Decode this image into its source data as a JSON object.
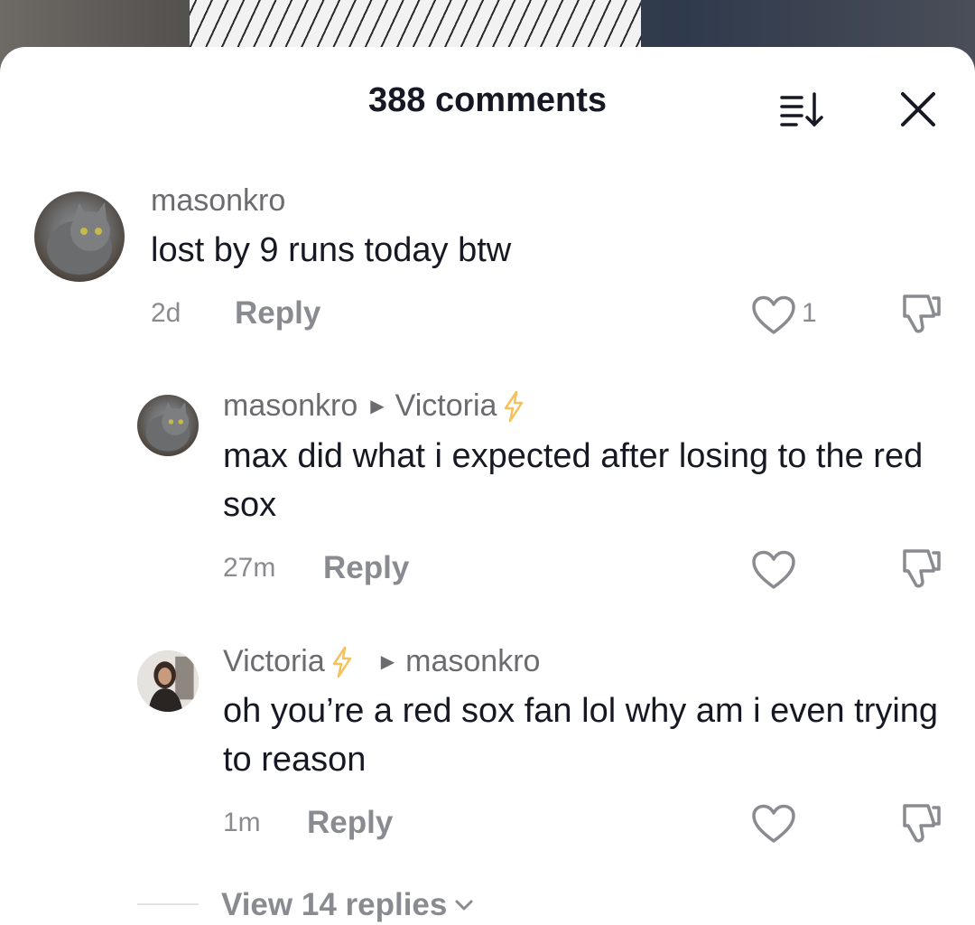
{
  "header": {
    "title": "388 comments"
  },
  "comments": [
    {
      "username": "masonkro",
      "text": "lost by 9 runs today btw",
      "time": "2d",
      "reply_label": "Reply",
      "likes": "1"
    },
    {
      "username": "masonkro",
      "reply_to": "Victoria",
      "text": "max did what i expected after losing to the red sox",
      "time": "27m",
      "reply_label": "Reply"
    },
    {
      "username": "Victoria",
      "reply_to": "masonkro",
      "text": "oh you’re a red sox fan lol why am i even trying to reason",
      "time": "1m",
      "reply_label": "Reply"
    }
  ],
  "view_replies": "View 14 replies",
  "colors": {
    "primary_text": "#161823",
    "secondary_text": "#8a8b91",
    "bolt": "#f5c15a"
  }
}
